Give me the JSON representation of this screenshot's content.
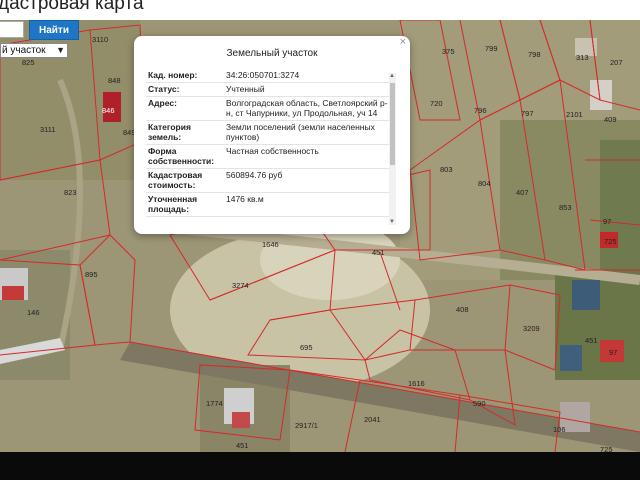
{
  "app": {
    "title": "дастровая карта"
  },
  "search": {
    "button_label": "Найти",
    "value": ""
  },
  "object_type": {
    "selected": "й участок"
  },
  "popup": {
    "title": "Земельный участок",
    "close": "×",
    "rows": [
      {
        "key": "Кад. номер:",
        "value": "34:26:050701:3274"
      },
      {
        "key": "Статус:",
        "value": "Учтенный"
      },
      {
        "key": "Адрес:",
        "value": "Волгоградская область, Светлоярский р-н, ст Чапурники, ул Продольная, уч 14"
      },
      {
        "key": "Категория земель:",
        "value": "Земли поселений (земли населенных пунктов)"
      },
      {
        "key": "Форма собственности:",
        "value": "Частная собственность"
      },
      {
        "key": "Кадастровая стоимость:",
        "value": "560894.76 руб"
      },
      {
        "key": "Уточненная площадь:",
        "value": "1476 кв.м"
      }
    ]
  },
  "map": {
    "parcel_labels": [
      "3110",
      "848",
      "846",
      "849",
      "3111",
      "825",
      "823",
      "895",
      "146",
      "1646",
      "3274",
      "451",
      "695",
      "375",
      "799",
      "798",
      "720",
      "796",
      "797",
      "803",
      "804",
      "407",
      "853",
      "408",
      "3209",
      "1616",
      "1774",
      "2917/1",
      "2041",
      "590",
      "106",
      "313",
      "207",
      "2101",
      "409",
      "97",
      "725",
      "451"
    ],
    "colors": {
      "parcel_line": "#d42a2a",
      "satellite": "#9a9575",
      "road": "#7e7762"
    }
  }
}
